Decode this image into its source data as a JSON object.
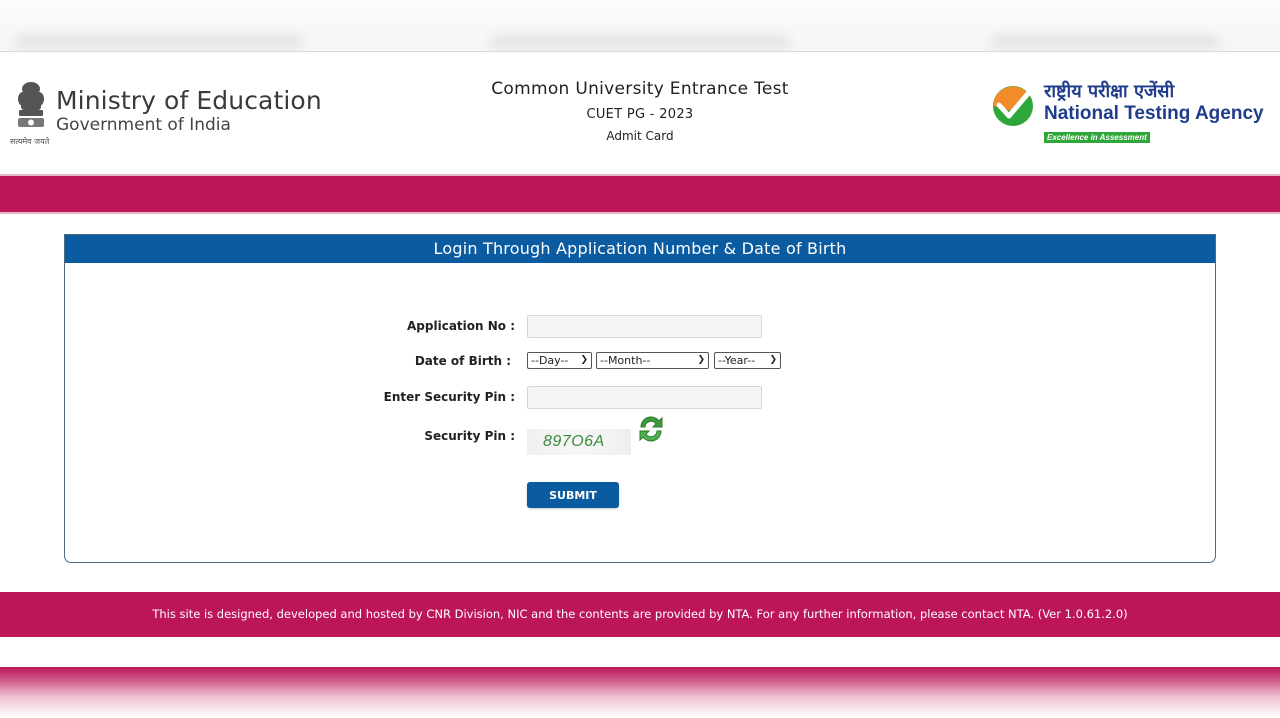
{
  "header": {
    "ministry": {
      "title": "Ministry of Education",
      "subtitle": "Government of India",
      "motto": "सत्यमेव जयते"
    },
    "center": {
      "title": "Common University Entrance Test",
      "exam": "CUET PG - 2023",
      "page": "Admit Card"
    },
    "agency": {
      "hindi_name": "राष्ट्रीय परीक्षा एजेंसी",
      "name": "National Testing Agency",
      "tagline": "Excellence in Assessment"
    }
  },
  "login": {
    "heading": "Login Through Application Number & Date of Birth",
    "application_no": {
      "label": "Application No :",
      "value": "",
      "placeholder": ""
    },
    "dob": {
      "label": "Date of Birth :",
      "day": "--Day--",
      "month": "--Month--",
      "year": "--Year--"
    },
    "security_pin_input": {
      "label": "Enter Security Pin :",
      "value": "",
      "placeholder": ""
    },
    "security_pin": {
      "label": "Security Pin :",
      "captcha": "897O6A",
      "refresh_icon": "refresh-icon"
    },
    "submit_label": "SUBMIT"
  },
  "footer": {
    "text": "This site is designed, developed and hosted by CNR Division, NIC and the contents are provided by NTA. For any further information, please contact NTA. (Ver 1.0.61.2.0)"
  },
  "colors": {
    "brand_magenta": "#bc1558",
    "brand_blue": "#0a5ba0",
    "captcha_green": "#3c8a3c"
  }
}
